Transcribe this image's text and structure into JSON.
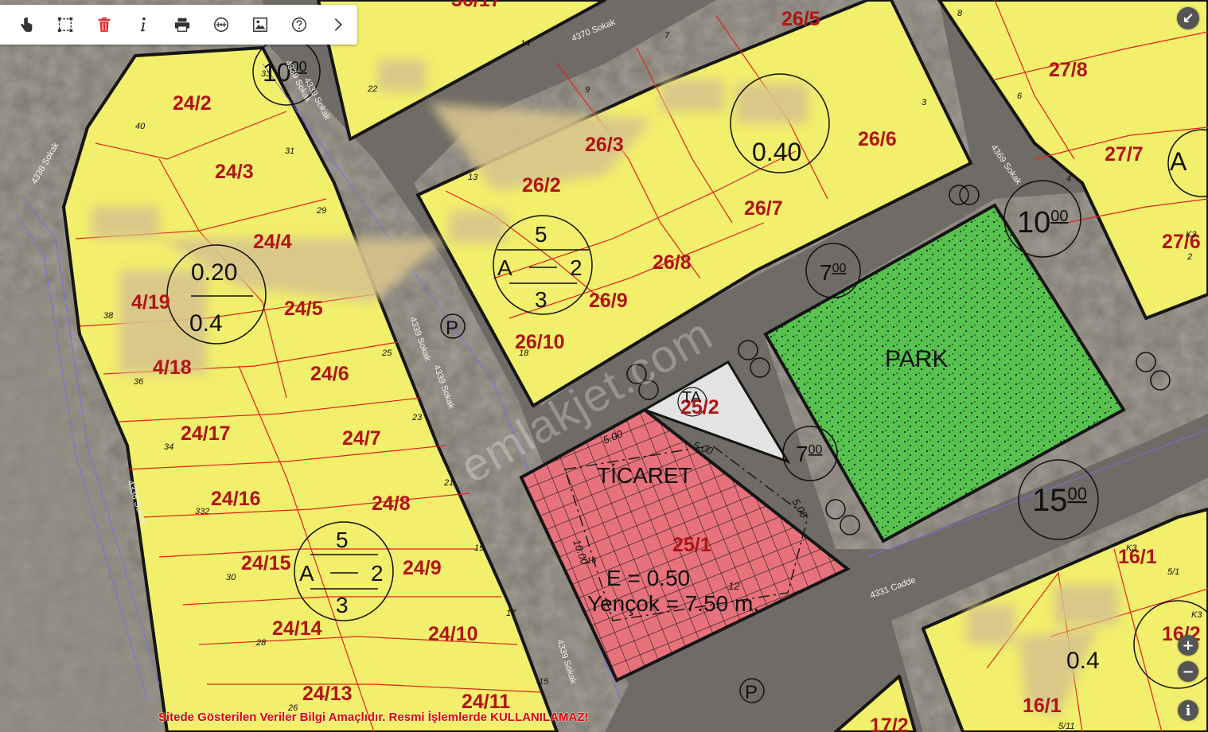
{
  "toolbar": {
    "items": [
      "pan-tool",
      "select-area",
      "delete",
      "info",
      "print",
      "measure",
      "export-image",
      "help",
      "next"
    ]
  },
  "colors": {
    "residential": "#f1ef6b",
    "commercial": "#e8727c",
    "park": "#58c24f",
    "road": "#6f6b66",
    "parcel_label": "#b01515",
    "parcel_line": "#e02020"
  },
  "parcels": [
    {
      "label": "26/5"
    },
    {
      "label": "27/8"
    },
    {
      "label": "24/2"
    },
    {
      "label": "26/6"
    },
    {
      "label": "0.40"
    },
    {
      "label": "27/7"
    },
    {
      "label": "24/3"
    },
    {
      "label": "26/3"
    },
    {
      "label": "26/2"
    },
    {
      "label": "26/7"
    },
    {
      "label": "27/6"
    },
    {
      "label": "26/8"
    },
    {
      "label": "26/9"
    },
    {
      "label": "4/19"
    },
    {
      "label": "24/5"
    },
    {
      "label": "24/4"
    },
    {
      "label": "26/10"
    },
    {
      "label": "24/6"
    },
    {
      "label": "4/18"
    },
    {
      "label": "24/17"
    },
    {
      "label": "24/7"
    },
    {
      "label": "24/16"
    },
    {
      "label": "24/8"
    },
    {
      "label": "24/15"
    },
    {
      "label": "24/9"
    },
    {
      "label": "24/14"
    },
    {
      "label": "24/10"
    },
    {
      "label": "24/13"
    },
    {
      "label": "24/11"
    },
    {
      "label": "25/2"
    },
    {
      "label": "25/1"
    },
    {
      "label": "16/1"
    },
    {
      "label": "16/2"
    },
    {
      "label": "16/1"
    },
    {
      "label": "17/2"
    },
    {
      "label": "36/17"
    }
  ],
  "park_label": "PARK",
  "ticaret_label": "TİCARET",
  "emsal_label": "E = 0.50",
  "yencok_label": "Yençok = 7.50 m.",
  "ta_label": "TA",
  "circle_labels": {
    "c1": "10.00",
    "c2": "0.40",
    "c3": "10.00",
    "c4": "7.00",
    "c5": "7.00",
    "c6": "15.00"
  },
  "circle_display": {
    "c1": "10",
    "c1sup": "00",
    "c3": "10",
    "c3sup": "00",
    "c4": "7",
    "c4sup": "00",
    "c5": "7",
    "c5sup": "00",
    "c6": "15",
    "c6sup": "00"
  },
  "density": {
    "d1": {
      "top": "5",
      "left": "A",
      "right": "2",
      "bottom": "3"
    },
    "d2": {
      "top": "5",
      "left": "A",
      "right": "2",
      "bottom": "3"
    }
  },
  "fractions": {
    "f1": "0.20",
    "f2": "0.4",
    "f3": "0.4",
    "f4": "A"
  },
  "parking": "P",
  "streets": {
    "s4370": "4370 Sokak",
    "s4339a": "4339 Sokak",
    "s4339b": "4339 Sokak",
    "s4339c": "4339 Sokak",
    "s4339d": "4339 Sokak",
    "s4339e": "4339 Sokak",
    "s4338a": "4338 Sokak",
    "s4338b": "4338 Sokak",
    "s4369": "4369 Sokak",
    "s4331": "4331 Cadde"
  },
  "setbacks": {
    "a": "5.00",
    "b": "5.00",
    "c": "5.00",
    "d": "10.00",
    "e": "12"
  },
  "lot_numbers": [
    "8",
    "14",
    "7",
    "33",
    "22",
    "9",
    "6",
    "3",
    "40",
    "31",
    "13",
    "4",
    "29",
    "2",
    "38",
    "25",
    "18",
    "36",
    "23",
    "34",
    "21",
    "332",
    "19",
    "30",
    "17",
    "28",
    "15",
    "26",
    "16",
    "5/1",
    "5/11",
    "K3",
    "K3",
    "K3"
  ],
  "watermark": "emlakjet.com",
  "disclaimer": "Sitede Gösterilen Veriler Bilgi Amaçlıdır. Resmi İşlemlerde KULLANILAMAZ!",
  "controls": {
    "collapse": "↙",
    "zoom_in": "+",
    "zoom_out": "−",
    "info": "i"
  }
}
